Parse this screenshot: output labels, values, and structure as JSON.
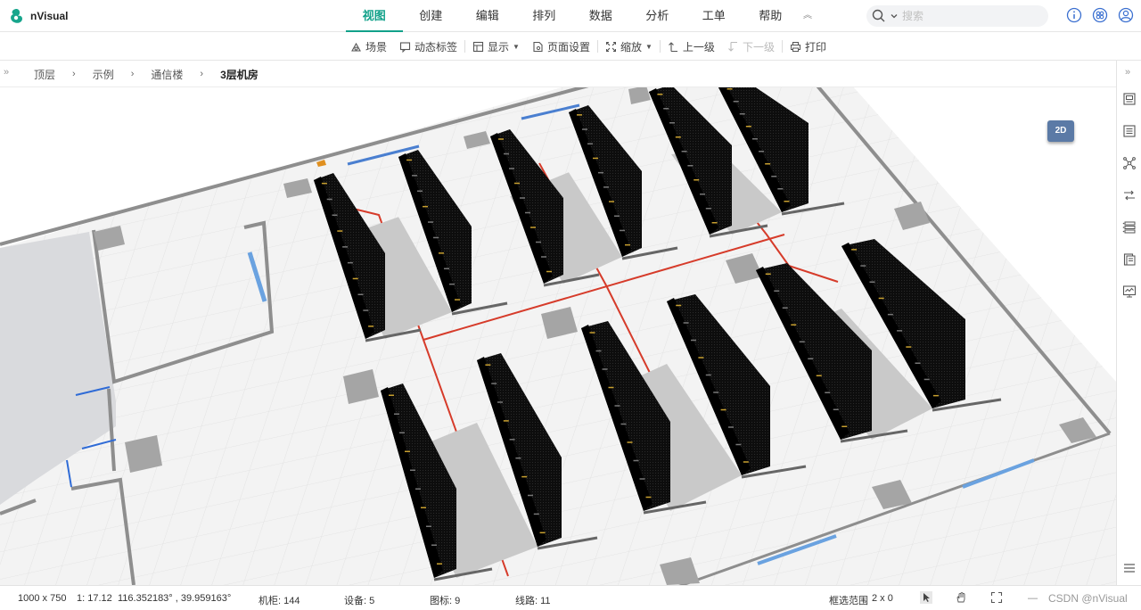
{
  "app": {
    "name": "nVisual"
  },
  "menu": {
    "items": [
      "视图",
      "创建",
      "编辑",
      "排列",
      "数据",
      "分析",
      "工单",
      "帮助"
    ],
    "active_index": 0,
    "collapse_icon": "chevrons-up-icon"
  },
  "search": {
    "placeholder": "搜索"
  },
  "top_icons": [
    "info-icon",
    "settings-icon",
    "user-icon"
  ],
  "toolbar": {
    "scene": "场景",
    "dynamic_label": "动态标签",
    "display": "显示",
    "page_setup": "页面设置",
    "zoom": "缩放",
    "up_level": "上一级",
    "down_level": "下一级",
    "print": "打印"
  },
  "breadcrumb": [
    "顶层",
    "示例",
    "通信楼",
    "3层机房"
  ],
  "view_toggle": "2D",
  "right_icons": [
    "image-icon",
    "list-icon",
    "network-icon",
    "route-icon",
    "rack-list-icon",
    "document-icon",
    "monitor-icon",
    "menu-icon"
  ],
  "status": {
    "size": "1000 x 750",
    "scale": "1: 17.12",
    "coords": "116.352183° , 39.959163°",
    "cabinets": "机柜: 144",
    "devices": "设备: 5",
    "icons": "图标: 9",
    "lines": "线路: 11",
    "selection_label": "框选范围",
    "selection_value": "2 x 0",
    "watermark": "CSDN @nVisual"
  },
  "colors": {
    "accent": "#12a18a",
    "link_blue": "#3a6fd0",
    "cable_red": "#d63b2a",
    "rack_black": "#0a0a0a",
    "floor": "#f3f3f3",
    "wall": "#8e8e8e",
    "button_2d": "#5b7aa6"
  }
}
